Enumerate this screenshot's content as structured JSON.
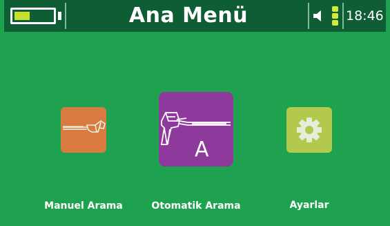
{
  "header": {
    "title": "Ana Menü",
    "time": "18:46",
    "battery_level": 0.4,
    "volume_icon": "speaker-icon",
    "signal_icon": "signal-level-icon"
  },
  "menu": {
    "items": [
      {
        "label": "Manuel Arama",
        "icon": "detector-icon",
        "color": "#d97a41"
      },
      {
        "label": "Otomatik Arama",
        "icon": "detector-auto-icon",
        "badge": "A",
        "color": "#8e3a9c"
      },
      {
        "label": "Ayarlar",
        "icon": "gear-icon",
        "color": "#b3c94e"
      }
    ]
  },
  "colors": {
    "background": "#1fa24f",
    "topbar": "#0e5d35",
    "battery_fill": "#c7df2e"
  }
}
